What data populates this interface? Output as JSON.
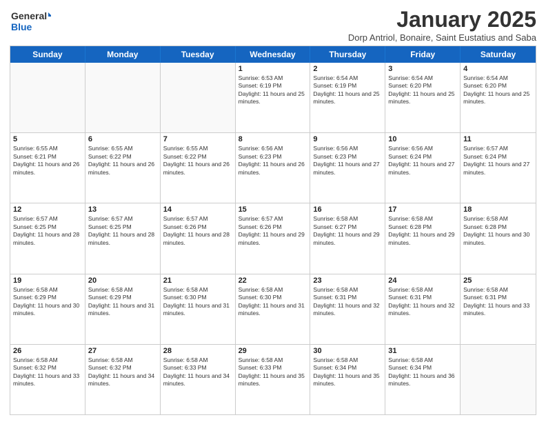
{
  "logo": {
    "line1": "General",
    "line2": "Blue"
  },
  "title": "January 2025",
  "subtitle": "Dorp Antriol, Bonaire, Saint Eustatius and Saba",
  "days_of_week": [
    "Sunday",
    "Monday",
    "Tuesday",
    "Wednesday",
    "Thursday",
    "Friday",
    "Saturday"
  ],
  "weeks": [
    [
      {
        "day": "",
        "sunrise": "",
        "sunset": "",
        "daylight": ""
      },
      {
        "day": "",
        "sunrise": "",
        "sunset": "",
        "daylight": ""
      },
      {
        "day": "",
        "sunrise": "",
        "sunset": "",
        "daylight": ""
      },
      {
        "day": "1",
        "sunrise": "Sunrise: 6:53 AM",
        "sunset": "Sunset: 6:19 PM",
        "daylight": "Daylight: 11 hours and 25 minutes."
      },
      {
        "day": "2",
        "sunrise": "Sunrise: 6:54 AM",
        "sunset": "Sunset: 6:19 PM",
        "daylight": "Daylight: 11 hours and 25 minutes."
      },
      {
        "day": "3",
        "sunrise": "Sunrise: 6:54 AM",
        "sunset": "Sunset: 6:20 PM",
        "daylight": "Daylight: 11 hours and 25 minutes."
      },
      {
        "day": "4",
        "sunrise": "Sunrise: 6:54 AM",
        "sunset": "Sunset: 6:20 PM",
        "daylight": "Daylight: 11 hours and 25 minutes."
      }
    ],
    [
      {
        "day": "5",
        "sunrise": "Sunrise: 6:55 AM",
        "sunset": "Sunset: 6:21 PM",
        "daylight": "Daylight: 11 hours and 26 minutes."
      },
      {
        "day": "6",
        "sunrise": "Sunrise: 6:55 AM",
        "sunset": "Sunset: 6:22 PM",
        "daylight": "Daylight: 11 hours and 26 minutes."
      },
      {
        "day": "7",
        "sunrise": "Sunrise: 6:55 AM",
        "sunset": "Sunset: 6:22 PM",
        "daylight": "Daylight: 11 hours and 26 minutes."
      },
      {
        "day": "8",
        "sunrise": "Sunrise: 6:56 AM",
        "sunset": "Sunset: 6:23 PM",
        "daylight": "Daylight: 11 hours and 26 minutes."
      },
      {
        "day": "9",
        "sunrise": "Sunrise: 6:56 AM",
        "sunset": "Sunset: 6:23 PM",
        "daylight": "Daylight: 11 hours and 27 minutes."
      },
      {
        "day": "10",
        "sunrise": "Sunrise: 6:56 AM",
        "sunset": "Sunset: 6:24 PM",
        "daylight": "Daylight: 11 hours and 27 minutes."
      },
      {
        "day": "11",
        "sunrise": "Sunrise: 6:57 AM",
        "sunset": "Sunset: 6:24 PM",
        "daylight": "Daylight: 11 hours and 27 minutes."
      }
    ],
    [
      {
        "day": "12",
        "sunrise": "Sunrise: 6:57 AM",
        "sunset": "Sunset: 6:25 PM",
        "daylight": "Daylight: 11 hours and 28 minutes."
      },
      {
        "day": "13",
        "sunrise": "Sunrise: 6:57 AM",
        "sunset": "Sunset: 6:25 PM",
        "daylight": "Daylight: 11 hours and 28 minutes."
      },
      {
        "day": "14",
        "sunrise": "Sunrise: 6:57 AM",
        "sunset": "Sunset: 6:26 PM",
        "daylight": "Daylight: 11 hours and 28 minutes."
      },
      {
        "day": "15",
        "sunrise": "Sunrise: 6:57 AM",
        "sunset": "Sunset: 6:26 PM",
        "daylight": "Daylight: 11 hours and 29 minutes."
      },
      {
        "day": "16",
        "sunrise": "Sunrise: 6:58 AM",
        "sunset": "Sunset: 6:27 PM",
        "daylight": "Daylight: 11 hours and 29 minutes."
      },
      {
        "day": "17",
        "sunrise": "Sunrise: 6:58 AM",
        "sunset": "Sunset: 6:28 PM",
        "daylight": "Daylight: 11 hours and 29 minutes."
      },
      {
        "day": "18",
        "sunrise": "Sunrise: 6:58 AM",
        "sunset": "Sunset: 6:28 PM",
        "daylight": "Daylight: 11 hours and 30 minutes."
      }
    ],
    [
      {
        "day": "19",
        "sunrise": "Sunrise: 6:58 AM",
        "sunset": "Sunset: 6:29 PM",
        "daylight": "Daylight: 11 hours and 30 minutes."
      },
      {
        "day": "20",
        "sunrise": "Sunrise: 6:58 AM",
        "sunset": "Sunset: 6:29 PM",
        "daylight": "Daylight: 11 hours and 31 minutes."
      },
      {
        "day": "21",
        "sunrise": "Sunrise: 6:58 AM",
        "sunset": "Sunset: 6:30 PM",
        "daylight": "Daylight: 11 hours and 31 minutes."
      },
      {
        "day": "22",
        "sunrise": "Sunrise: 6:58 AM",
        "sunset": "Sunset: 6:30 PM",
        "daylight": "Daylight: 11 hours and 31 minutes."
      },
      {
        "day": "23",
        "sunrise": "Sunrise: 6:58 AM",
        "sunset": "Sunset: 6:31 PM",
        "daylight": "Daylight: 11 hours and 32 minutes."
      },
      {
        "day": "24",
        "sunrise": "Sunrise: 6:58 AM",
        "sunset": "Sunset: 6:31 PM",
        "daylight": "Daylight: 11 hours and 32 minutes."
      },
      {
        "day": "25",
        "sunrise": "Sunrise: 6:58 AM",
        "sunset": "Sunset: 6:31 PM",
        "daylight": "Daylight: 11 hours and 33 minutes."
      }
    ],
    [
      {
        "day": "26",
        "sunrise": "Sunrise: 6:58 AM",
        "sunset": "Sunset: 6:32 PM",
        "daylight": "Daylight: 11 hours and 33 minutes."
      },
      {
        "day": "27",
        "sunrise": "Sunrise: 6:58 AM",
        "sunset": "Sunset: 6:32 PM",
        "daylight": "Daylight: 11 hours and 34 minutes."
      },
      {
        "day": "28",
        "sunrise": "Sunrise: 6:58 AM",
        "sunset": "Sunset: 6:33 PM",
        "daylight": "Daylight: 11 hours and 34 minutes."
      },
      {
        "day": "29",
        "sunrise": "Sunrise: 6:58 AM",
        "sunset": "Sunset: 6:33 PM",
        "daylight": "Daylight: 11 hours and 35 minutes."
      },
      {
        "day": "30",
        "sunrise": "Sunrise: 6:58 AM",
        "sunset": "Sunset: 6:34 PM",
        "daylight": "Daylight: 11 hours and 35 minutes."
      },
      {
        "day": "31",
        "sunrise": "Sunrise: 6:58 AM",
        "sunset": "Sunset: 6:34 PM",
        "daylight": "Daylight: 11 hours and 36 minutes."
      },
      {
        "day": "",
        "sunrise": "",
        "sunset": "",
        "daylight": ""
      }
    ]
  ]
}
